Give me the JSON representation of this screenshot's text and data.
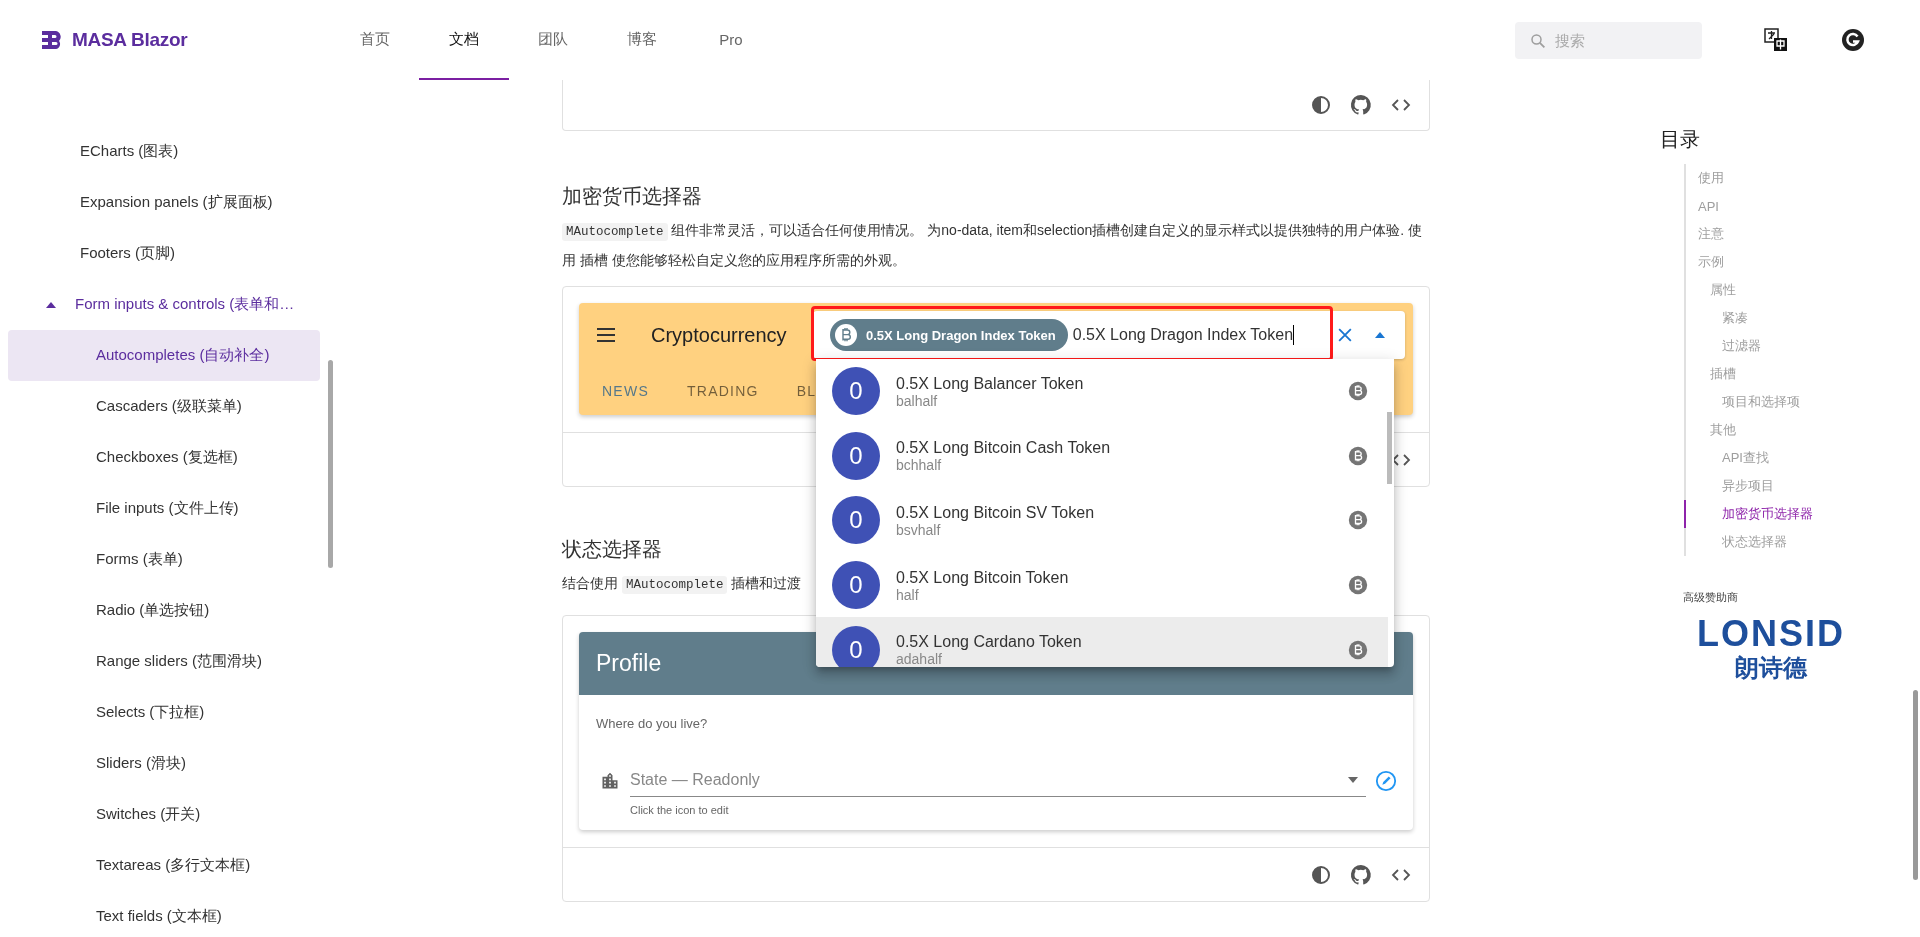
{
  "header": {
    "brand": "MASA Blazor",
    "nav": [
      {
        "label": "首页",
        "selected": false
      },
      {
        "label": "文档",
        "selected": true
      },
      {
        "label": "团队",
        "selected": false
      },
      {
        "label": "博客",
        "selected": false
      },
      {
        "label": "Pro",
        "selected": false
      }
    ],
    "search": {
      "placeholder": "搜索"
    }
  },
  "sidebar": {
    "items": [
      {
        "kind": "page",
        "label": "ECharts (图表)",
        "selected": false
      },
      {
        "kind": "page",
        "label": "Expansion panels (扩展面板)",
        "selected": false
      },
      {
        "kind": "page",
        "label": "Footers (页脚)",
        "selected": false
      },
      {
        "kind": "group",
        "label": "Form inputs & controls (表单和…",
        "expanded": true,
        "selected": false,
        "children": [
          {
            "label": "Autocompletes (自动补全)",
            "selected": true
          },
          {
            "label": "Cascaders (级联菜单)",
            "selected": false
          },
          {
            "label": "Checkboxes (复选框)",
            "selected": false
          },
          {
            "label": "File inputs (文件上传)",
            "selected": false
          },
          {
            "label": "Forms (表单)",
            "selected": false
          },
          {
            "label": "Radio (单选按钮)",
            "selected": false
          },
          {
            "label": "Range sliders (范围滑块)",
            "selected": false
          },
          {
            "label": "Selects (下拉框)",
            "selected": false
          },
          {
            "label": "Sliders (滑块)",
            "selected": false
          },
          {
            "label": "Switches (开关)",
            "selected": false
          },
          {
            "label": "Textareas (多行文本框)",
            "selected": false
          },
          {
            "label": "Text fields (文本框)",
            "selected": false
          }
        ]
      }
    ]
  },
  "crypto_section": {
    "heading": "加密货币选择器",
    "description": [
      {
        "kind": "code",
        "text": "MAutocomplete"
      },
      {
        "kind": "text",
        "text": " 组件非常灵活，可以适合任何使用情况。 为no-data, item和selection插槽创建自定义的显示样式以提供独特的用户体验. 使用 插槽 使您能够轻松自定义您的应用程序所需的外观。"
      }
    ],
    "toolbar": {
      "title": "Cryptocurrency",
      "tabs": [
        {
          "label": "NEWS",
          "selected": true
        },
        {
          "label": "TRADING",
          "selected": false
        },
        {
          "label": "BL",
          "selected": false
        }
      ]
    },
    "autocomplete": {
      "chip": "0.5X Long Dragon Index Token",
      "value": "0.5X Long Dragon Index Token"
    },
    "menu": [
      {
        "avatar": "0",
        "name": "0.5X Long Balancer Token",
        "symbol": "balhalf",
        "hovered": false
      },
      {
        "avatar": "0",
        "name": "0.5X Long Bitcoin Cash Token",
        "symbol": "bchhalf",
        "hovered": false
      },
      {
        "avatar": "0",
        "name": "0.5X Long Bitcoin SV Token",
        "symbol": "bsvhalf",
        "hovered": false
      },
      {
        "avatar": "0",
        "name": "0.5X Long Bitcoin Token",
        "symbol": "half",
        "hovered": false
      },
      {
        "avatar": "0",
        "name": "0.5X Long Cardano Token",
        "symbol": "adahalf",
        "hovered": true
      }
    ]
  },
  "state_section": {
    "heading": "状态选择器",
    "description": [
      {
        "kind": "text",
        "text": "结合使用 "
      },
      {
        "kind": "code",
        "text": "MAutocomplete"
      },
      {
        "kind": "text",
        "text": " 插槽和过渡"
      }
    ],
    "profile": {
      "title": "Profile",
      "prompt": "Where do you live?",
      "field": {
        "placeholder": "State — Readonly",
        "hint": "Click the icon to edit"
      }
    }
  },
  "toc": {
    "title": "目录",
    "items": [
      {
        "label": "使用",
        "selected": false
      },
      {
        "label": "API",
        "selected": false
      },
      {
        "label": "注意",
        "selected": false
      },
      {
        "label": "示例",
        "selected": false,
        "children": [
          {
            "label": "属性",
            "selected": false,
            "children": [
              {
                "label": "紧凑",
                "selected": false
              },
              {
                "label": "过滤器",
                "selected": false
              }
            ]
          },
          {
            "label": "插槽",
            "selected": false,
            "children": [
              {
                "label": "项目和选择项",
                "selected": false
              }
            ]
          },
          {
            "label": "其他",
            "selected": false,
            "children": [
              {
                "label": "API查找",
                "selected": false
              },
              {
                "label": "异步项目",
                "selected": false
              },
              {
                "label": "加密货币选择器",
                "selected": true
              },
              {
                "label": "状态选择器",
                "selected": false
              }
            ]
          }
        ]
      }
    ]
  },
  "sponsor": {
    "label": "高级赞助商",
    "logo_text": "LONSID",
    "logo_subtext": "朗诗德"
  }
}
